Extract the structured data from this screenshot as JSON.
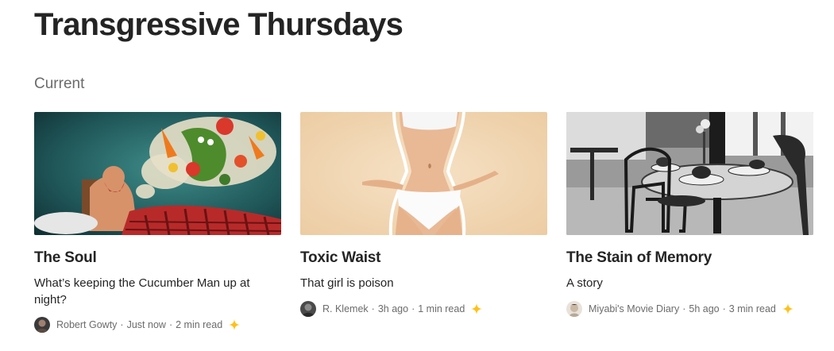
{
  "page": {
    "title": "Transgressive Thursdays",
    "section_label": "Current"
  },
  "colors": {
    "text_primary": "#242424",
    "text_secondary": "#6b6b6b",
    "member_star": "#ffc017"
  },
  "cards": [
    {
      "title": "The Soul",
      "subtitle": "What’s keeping the Cucumber Man up at night?",
      "author": "Robert Gowty",
      "time": "Just now",
      "read_time": "2 min read",
      "separator": "·",
      "image_icon": "cucumber-dream-illustration",
      "member_icon": "sparkle-star-icon"
    },
    {
      "title": "Toxic Waist",
      "subtitle": "That girl is poison",
      "author": "R. Klemek",
      "time": "3h ago",
      "read_time": "1 min read",
      "separator": "·",
      "image_icon": "waist-photo",
      "member_icon": "sparkle-star-icon"
    },
    {
      "title": "The Stain of Memory",
      "subtitle": "A story",
      "author": "Miyabi's Movie Diary",
      "time": "5h ago",
      "read_time": "3 min read",
      "separator": "·",
      "image_icon": "cafe-table-photo",
      "member_icon": "sparkle-star-icon"
    }
  ]
}
